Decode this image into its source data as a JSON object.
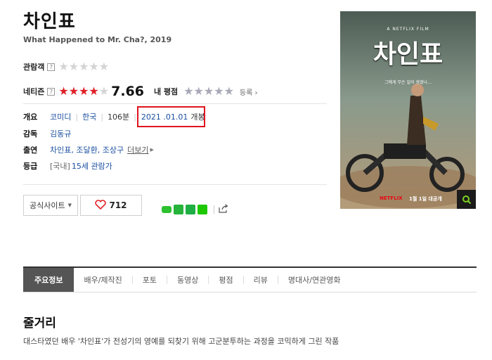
{
  "movie": {
    "title": "차인표",
    "subtitle": "What Happened to Mr. Cha?, 2019"
  },
  "ratings": {
    "audience_label": "관람객",
    "netizen_label": "네티즌",
    "netizen_score": "7.66",
    "netizen_stars_filled": 4,
    "my_rating_label": "내 평점",
    "register_label": "등록",
    "help_glyph": "?"
  },
  "info": {
    "overview_label": "개요",
    "genre": "코미디",
    "country": "한국",
    "runtime": "106분",
    "release_date": "2021 .01.01",
    "release_suffix": "개봉",
    "director_label": "감독",
    "director": "김동규",
    "cast_label": "출연",
    "cast": "차인표, 조달환, 조상구",
    "more_label": "더보기",
    "grade_label": "등급",
    "grade_prefix": "[국내]",
    "grade": "15세 관람가"
  },
  "actions": {
    "official_site_label": "공식사이트",
    "like_count": "712"
  },
  "poster": {
    "badge": "A NETFLIX FILM",
    "title": "차인표",
    "tagline": "그에게 무슨 일이 생겼나…",
    "brand": "NETFLIX",
    "date_text": "1월 1일 대공개"
  },
  "tabs": [
    {
      "label": "주요정보",
      "active": true
    },
    {
      "label": "배우/제작진",
      "active": false
    },
    {
      "label": "포토",
      "active": false
    },
    {
      "label": "동영상",
      "active": false
    },
    {
      "label": "평점",
      "active": false
    },
    {
      "label": "리뷰",
      "active": false
    },
    {
      "label": "명대사/연관영화",
      "active": false
    }
  ],
  "synopsis": {
    "title": "줄거리",
    "text": "대스타였던 배우 '차인표'가 전성기의 영예를 되찾기 위해 고군분투하는 과정을 코믹하게 그린 작품"
  },
  "colors": {
    "star_red": "#e01f26",
    "highlight_box": "#e0141e",
    "link_blue": "#1a4fa0",
    "active_tab": "#555555"
  }
}
